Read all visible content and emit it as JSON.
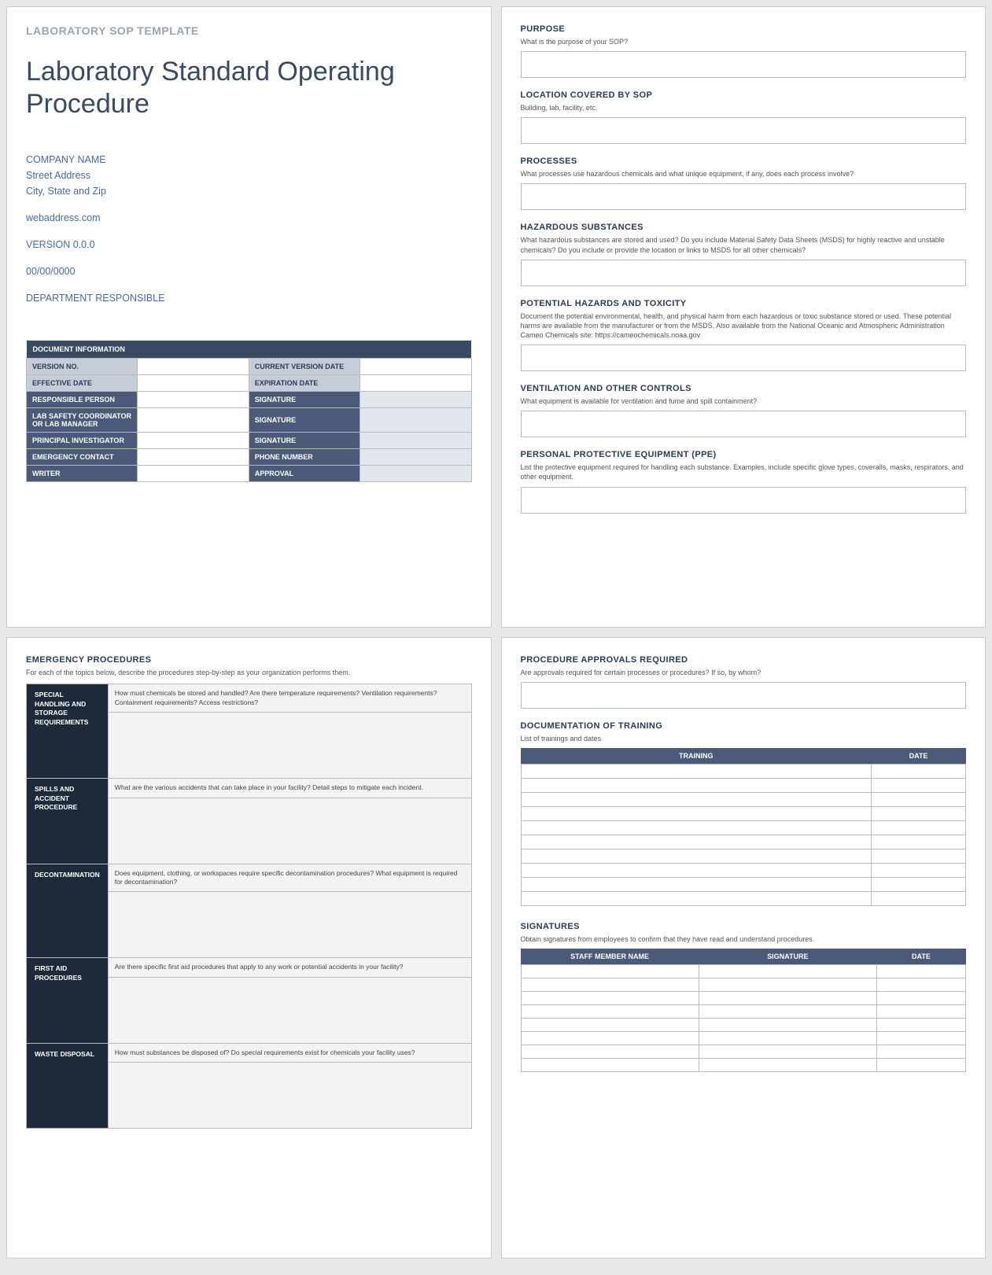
{
  "header": {
    "template_label": "LABORATORY SOP TEMPLATE"
  },
  "title": "Laboratory Standard Operating Procedure",
  "meta": {
    "company": "COMPANY NAME",
    "street": "Street Address",
    "citystate": "City, State and Zip",
    "web": "webaddress.com",
    "version": "VERSION 0.0.0",
    "date": "00/00/0000",
    "dept": "DEPARTMENT RESPONSIBLE"
  },
  "docinfo": {
    "heading": "DOCUMENT INFORMATION",
    "rows": [
      {
        "l1": "VERSION NO.",
        "l2": "CURRENT VERSION DATE",
        "style": "lt"
      },
      {
        "l1": "EFFECTIVE DATE",
        "l2": "EXPIRATION DATE",
        "style": "lt"
      },
      {
        "l1": "RESPONSIBLE PERSON",
        "l2": "SIGNATURE",
        "style": "dk"
      },
      {
        "l1": "LAB SAFETY COORDINATOR OR LAB MANAGER",
        "l2": "SIGNATURE",
        "style": "dk"
      },
      {
        "l1": "PRINCIPAL INVESTIGATOR",
        "l2": "SIGNATURE",
        "style": "dk"
      },
      {
        "l1": "EMERGENCY CONTACT",
        "l2": "PHONE NUMBER",
        "style": "dk"
      },
      {
        "l1": "WRITER",
        "l2": "APPROVAL",
        "style": "dk"
      }
    ]
  },
  "p2": [
    {
      "h": "PURPOSE",
      "d": "What is the purpose of your SOP?"
    },
    {
      "h": "LOCATION COVERED BY SOP",
      "d": "Building, lab, facility, etc."
    },
    {
      "h": "PROCESSES",
      "d": "What processes use hazardous chemicals and what unique equipment, if any, does each process involve?"
    },
    {
      "h": "HAZARDOUS SUBSTANCES",
      "d": "What hazardous substances are stored and used? Do you include Material Safety Data Sheets (MSDS) for highly reactive and unstable chemicals? Do you include or provide the location or links to MSDS for all other chemicals?"
    },
    {
      "h": "POTENTIAL HAZARDS AND TOXICITY",
      "d": "Document the potential environmental, health, and physical harm from each hazardous or toxic substance stored or used. These potential harms are available from the manufacturer or from the MSDS. Also available from the National Oceanic and Atmospheric Administration Cameo Chemicals site: https://cameochemicals.noaa.gov"
    },
    {
      "h": "VENTILATION AND OTHER CONTROLS",
      "d": "What equipment is available for ventilation and fume and spill containment?"
    },
    {
      "h": "PERSONAL PROTECTIVE EQUIPMENT (PPE)",
      "d": "List the protective equipment required for handling each substance. Examples, include specific glove types, coveralls, masks, respirators, and other equipment."
    }
  ],
  "p3": {
    "heading": "EMERGENCY PROCEDURES",
    "desc": "For each of the topics below, describe the procedures step-by-step as your organization performs them.",
    "rows": [
      {
        "h": "SPECIAL HANDLING AND STORAGE REQUIREMENTS",
        "p": "How must chemicals be stored and handled? Are there temperature requirements? Ventilation requirements? Containment requirements? Access restrictions?"
      },
      {
        "h": "SPILLS AND ACCIDENT PROCEDURE",
        "p": "What are the various accidents that can take place in your facility? Detail steps to mitigate each incident."
      },
      {
        "h": "DECONTAMINATION",
        "p": "Does equipment, clothing, or workspaces require specific decontamination procedures? What equipment is required for decontamination?"
      },
      {
        "h": "FIRST AID PROCEDURES",
        "p": "Are there specific first aid procedures that apply to any work or potential accidents in your facility?"
      },
      {
        "h": "WASTE DISPOSAL",
        "p": "How must substances be disposed of? Do special requirements exist for chemicals your facility uses?"
      }
    ]
  },
  "p4": {
    "approvals": {
      "h": "PROCEDURE APPROVALS REQUIRED",
      "d": "Are approvals required for certain processes or procedures?  If so, by whom?"
    },
    "training": {
      "h": "DOCUMENTATION OF TRAINING",
      "d": "List of trainings and dates",
      "col1": "TRAINING",
      "col2": "DATE",
      "rows": 10
    },
    "signatures": {
      "h": "SIGNATURES",
      "d": "Obtain signatures from employees to confirm that they have read and understand procedures.",
      "c1": "STAFF MEMBER NAME",
      "c2": "SIGNATURE",
      "c3": "DATE",
      "rows": 8
    }
  }
}
